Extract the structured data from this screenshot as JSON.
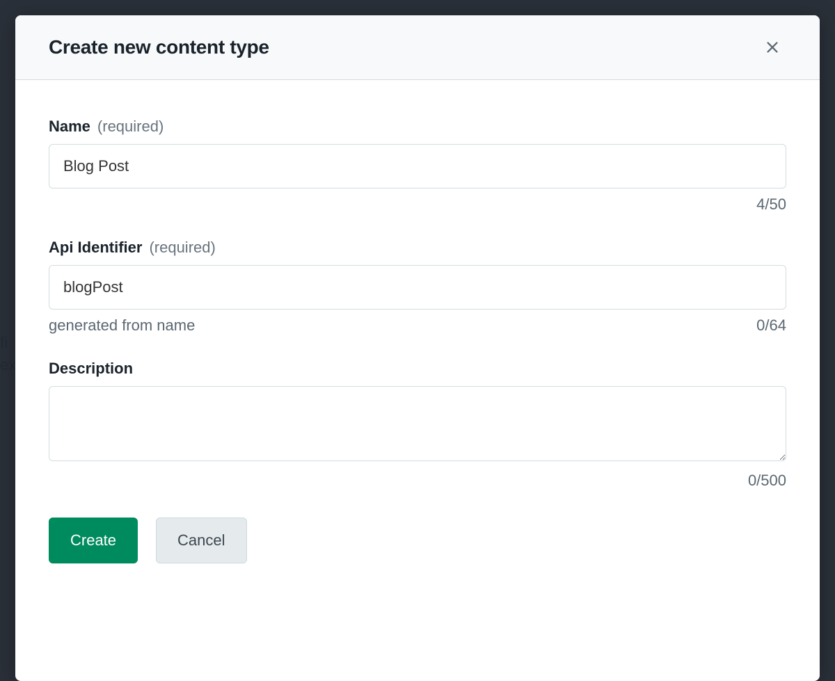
{
  "modal": {
    "title": "Create new content type",
    "fields": {
      "name": {
        "label": "Name",
        "required_text": "(required)",
        "value": "Blog Post",
        "counter": "4/50"
      },
      "api_identifier": {
        "label": "Api Identifier",
        "required_text": "(required)",
        "value": "blogPost",
        "helper": "generated from name",
        "counter": "0/64"
      },
      "description": {
        "label": "Description",
        "value": "",
        "counter": "0/500"
      }
    },
    "actions": {
      "create": "Create",
      "cancel": "Cancel"
    }
  }
}
